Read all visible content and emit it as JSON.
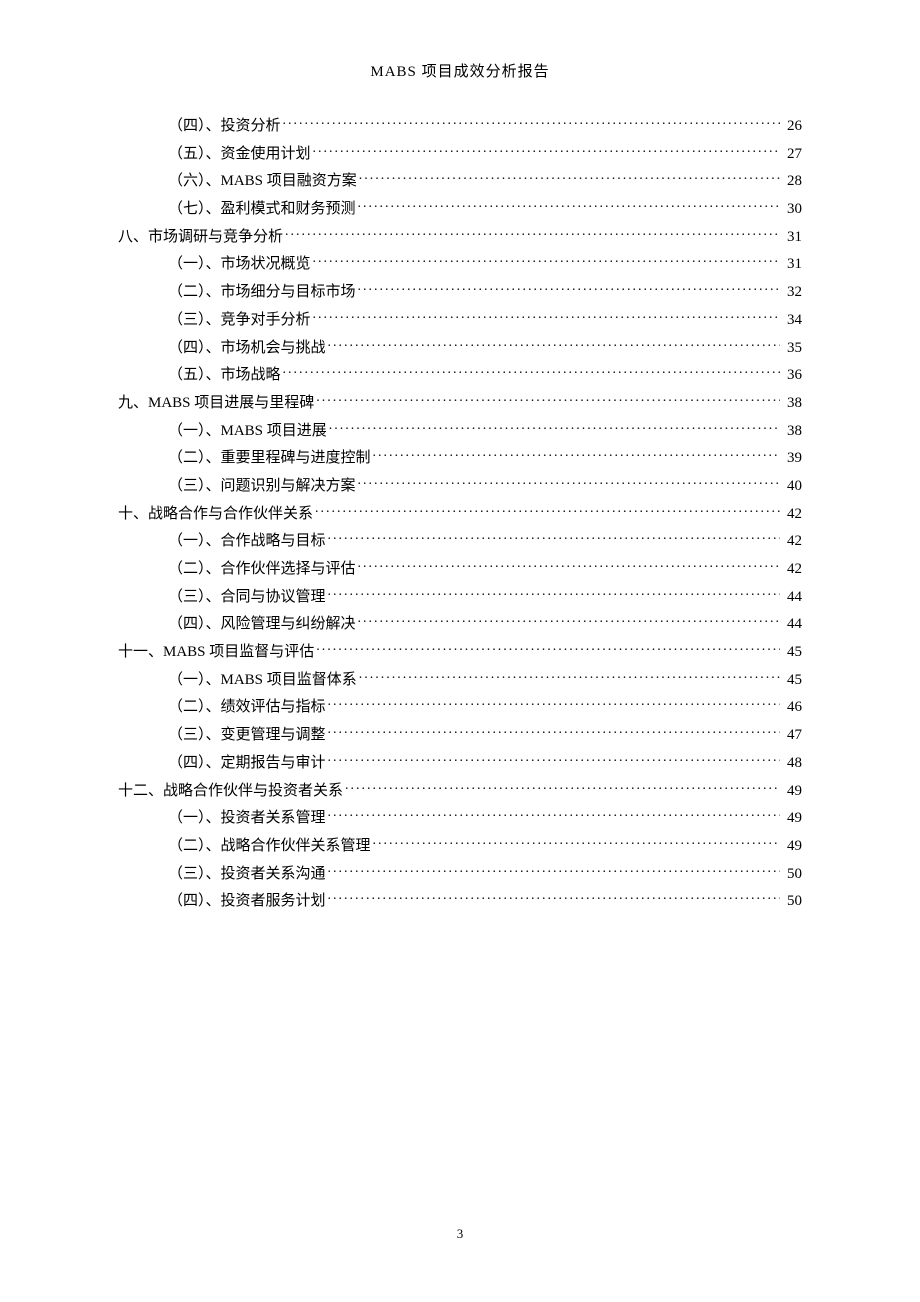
{
  "header_title": "MABS 项目成效分析报告",
  "page_number": "3",
  "toc": [
    {
      "level": 2,
      "label": "（四）、投资分析",
      "page": "26"
    },
    {
      "level": 2,
      "label": "（五）、资金使用计划",
      "page": "27"
    },
    {
      "level": 2,
      "label": "（六）、MABS 项目融资方案",
      "page": "28"
    },
    {
      "level": 2,
      "label": "（七）、盈利模式和财务预测",
      "page": "30"
    },
    {
      "level": 1,
      "label": "八、市场调研与竞争分析",
      "page": "31"
    },
    {
      "level": 2,
      "label": "（一）、市场状况概览",
      "page": "31"
    },
    {
      "level": 2,
      "label": "（二）、市场细分与目标市场",
      "page": "32"
    },
    {
      "level": 2,
      "label": "（三）、竞争对手分析",
      "page": "34"
    },
    {
      "level": 2,
      "label": "（四）、市场机会与挑战",
      "page": "35"
    },
    {
      "level": 2,
      "label": "（五）、市场战略",
      "page": "36"
    },
    {
      "level": 1,
      "label": "九、MABS 项目进展与里程碑",
      "page": "38"
    },
    {
      "level": 2,
      "label": "（一）、MABS 项目进展",
      "page": "38"
    },
    {
      "level": 2,
      "label": "（二）、重要里程碑与进度控制",
      "page": "39"
    },
    {
      "level": 2,
      "label": "（三）、问题识别与解决方案",
      "page": "40"
    },
    {
      "level": 1,
      "label": "十、战略合作与合作伙伴关系",
      "page": "42"
    },
    {
      "level": 2,
      "label": "（一）、合作战略与目标",
      "page": "42"
    },
    {
      "level": 2,
      "label": "（二）、合作伙伴选择与评估",
      "page": "42"
    },
    {
      "level": 2,
      "label": "（三）、合同与协议管理",
      "page": "44"
    },
    {
      "level": 2,
      "label": "（四）、风险管理与纠纷解决",
      "page": "44"
    },
    {
      "level": 1,
      "label": "十一、MABS 项目监督与评估",
      "page": "45"
    },
    {
      "level": 2,
      "label": "（一）、MABS 项目监督体系",
      "page": "45"
    },
    {
      "level": 2,
      "label": "（二）、绩效评估与指标",
      "page": "46"
    },
    {
      "level": 2,
      "label": "（三）、变更管理与调整",
      "page": "47"
    },
    {
      "level": 2,
      "label": "（四）、定期报告与审计",
      "page": "48"
    },
    {
      "level": 1,
      "label": "十二、战略合作伙伴与投资者关系",
      "page": "49"
    },
    {
      "level": 2,
      "label": "（一）、投资者关系管理",
      "page": "49"
    },
    {
      "level": 2,
      "label": "（二）、战略合作伙伴关系管理",
      "page": "49"
    },
    {
      "level": 2,
      "label": "（三）、投资者关系沟通",
      "page": "50"
    },
    {
      "level": 2,
      "label": "（四）、投资者服务计划",
      "page": "50"
    }
  ]
}
